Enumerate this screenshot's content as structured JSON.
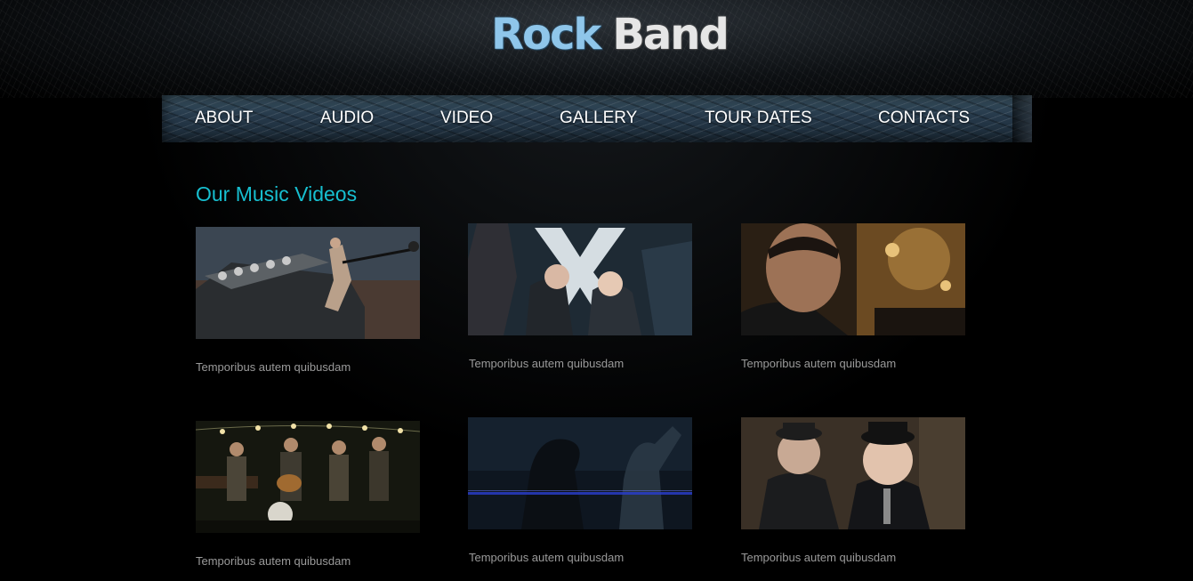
{
  "header": {
    "logo_word1": "Rock",
    "logo_word2": "Band"
  },
  "nav": {
    "items": [
      {
        "label": "ABOUT"
      },
      {
        "label": "AUDIO"
      },
      {
        "label": "VIDEO"
      },
      {
        "label": "GALLERY"
      },
      {
        "label": "TOUR DATES"
      },
      {
        "label": "CONTACTS"
      }
    ]
  },
  "main": {
    "title": "Our Music Videos",
    "videos": [
      {
        "caption": "Temporibus autem quibusdam",
        "thumbnail": "rock-singer-on-truck"
      },
      {
        "caption": "Temporibus autem quibusdam",
        "thumbnail": "couple-kiss-x-logo"
      },
      {
        "caption": "Temporibus autem quibusdam",
        "thumbnail": "singer-closeup-club"
      },
      {
        "caption": "Temporibus autem quibusdam",
        "thumbnail": "folk-band-with-bulbs"
      },
      {
        "caption": "Temporibus autem quibusdam",
        "thumbnail": "dancing-silhouette"
      },
      {
        "caption": "Temporibus autem quibusdam",
        "thumbnail": "two-men-in-hats"
      }
    ]
  },
  "colors": {
    "background": "#000000",
    "accent": "#17bfd0",
    "caption": "#9a9a9a",
    "nav_text": "#ffffff"
  }
}
